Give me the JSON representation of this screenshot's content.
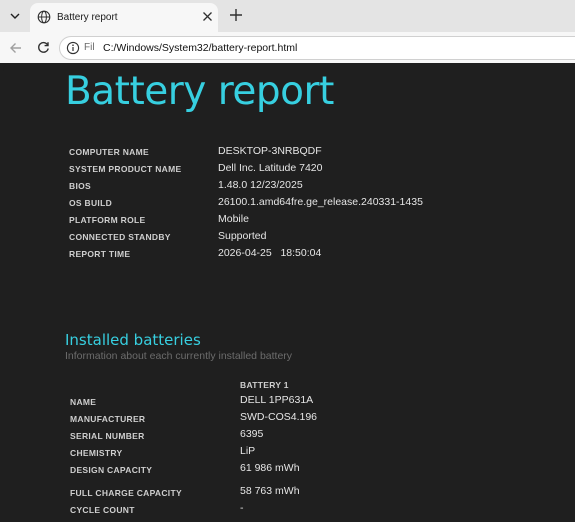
{
  "browser": {
    "tab_title": "Battery report",
    "url_scheme": "Fil",
    "url": "C:/Windows/System32/battery-report.html"
  },
  "report": {
    "title": "Battery report",
    "system_info": [
      {
        "label": "COMPUTER NAME",
        "value": "DESKTOP-3NRBQDF"
      },
      {
        "label": "SYSTEM PRODUCT NAME",
        "value": "Dell Inc. Latitude 7420"
      },
      {
        "label": "BIOS",
        "value": "1.48.0 12/23/2025"
      },
      {
        "label": "OS BUILD",
        "value": "26100.1.amd64fre.ge_release.240331-1435"
      },
      {
        "label": "PLATFORM ROLE",
        "value": "Mobile"
      },
      {
        "label": "CONNECTED STANDBY",
        "value": "Supported"
      },
      {
        "label": "REPORT TIME",
        "value": "2026-04-25   18:50:04"
      }
    ],
    "installed_batteries": {
      "heading": "Installed batteries",
      "subtitle": "Information about each currently installed battery",
      "column_header": "BATTERY 1",
      "rows": [
        {
          "label": "NAME",
          "value": "DELL 1PP631A"
        },
        {
          "label": "MANUFACTURER",
          "value": "SWD-COS4.196"
        },
        {
          "label": "SERIAL NUMBER",
          "value": "6395"
        },
        {
          "label": "CHEMISTRY",
          "value": "LiP"
        },
        {
          "label": "DESIGN CAPACITY",
          "value": "61 986 mWh"
        },
        {
          "label": "FULL CHARGE CAPACITY",
          "value": "58 763 mWh"
        },
        {
          "label": "CYCLE COUNT",
          "value": "-"
        }
      ]
    }
  }
}
